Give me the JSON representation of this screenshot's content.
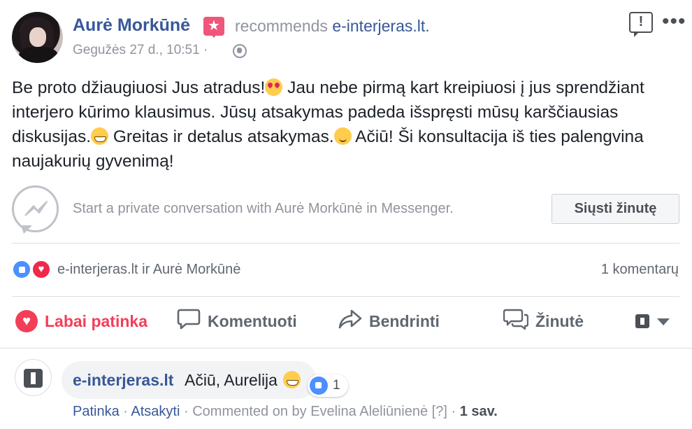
{
  "post": {
    "author": "Aurė Morkūnė",
    "action_text": "recommends",
    "page_name": "e-interjeras.lt",
    "page_suffix": ".",
    "timestamp": "Gegužės 27 d., 10:51",
    "separator": "·",
    "badge_icon": "star-badge-icon",
    "body_parts": [
      "Be proto džiaugiuosi Jus atradus!",
      " Jau nebe pirmą kart kreipiuosi į jus sprendžiant interjero kūrimo klausimus. Jūsų atsakymas padeda išspręsti mūsų karščiausias diskusijas.",
      " Greitas ir detalus atsakymas.",
      " Ačiū! Ši konsultacija iš ties palengvina naujakurių gyvenimą!"
    ]
  },
  "messenger": {
    "prompt": "Start a private conversation with Aurė Morkūnė in Messenger.",
    "button_label": "Siųsti žinutę"
  },
  "reactions": {
    "names": "e-interjeras.lt ir Aurė Morkūnė",
    "comments_count": "1 komentarų"
  },
  "actions": {
    "like": "Labai patinka",
    "comment": "Komentuoti",
    "share": "Bendrinti",
    "message": "Žinutė"
  },
  "comment": {
    "author": "e-interjeras.lt",
    "text": "Ačiū, Aurelija",
    "reaction_count": "1",
    "like_link": "Patinka",
    "reply_link": "Atsakyti",
    "dot": "·",
    "commented_on": "Commented on by Evelina Aleliūnienė",
    "help": "[?]",
    "age": "1 sav."
  },
  "colors": {
    "link_blue": "#385898",
    "love_red": "#f33e58",
    "muted": "#90949c"
  }
}
